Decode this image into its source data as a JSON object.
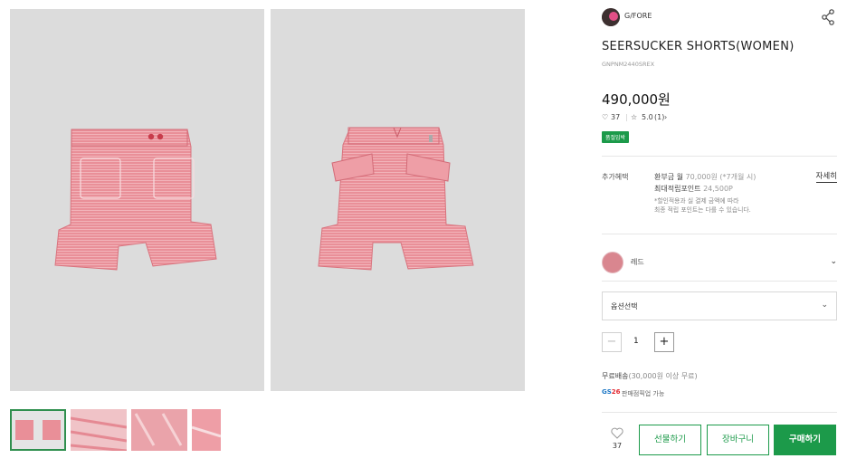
{
  "brand": {
    "name": "G/FORE"
  },
  "product": {
    "title": "SEERSUCKER SHORTS(WOMEN)",
    "code": "GNPNM2440SREX",
    "price": "490,000원",
    "likes": "37",
    "rating": "5.0",
    "reviews": "(1)",
    "badge": "품절임박"
  },
  "benefits": {
    "label": "추가혜택",
    "line1_main": "환부금 월 ",
    "line1_muted": "70,000원 (*7개월 시)",
    "line2_main": "최대적립포인트 ",
    "line2_muted": "24,500P",
    "note1": "*할인적용과 실 결제 금액에 따라",
    "note2": "최종 적립 포인트는 다를 수 있습니다.",
    "detail_link": "자세히"
  },
  "color": {
    "name": "레드",
    "hex": "#d9868f"
  },
  "option": {
    "placeholder": "옵션선택"
  },
  "quantity": {
    "value": "1",
    "minus": "−",
    "plus": "+"
  },
  "shipping": {
    "main": "무료배송",
    "muted": "(30,000원 이상 무료)"
  },
  "gs": {
    "logo_a": "GS",
    "logo_b": "26",
    "text": "판매점픽업 가능"
  },
  "actions": {
    "wish_count": "37",
    "gift": "선물하기",
    "cart": "장바구니",
    "buy": "구매하기"
  },
  "colors": {
    "accent": "#1c9a4a",
    "fabric": "#e88a93"
  }
}
